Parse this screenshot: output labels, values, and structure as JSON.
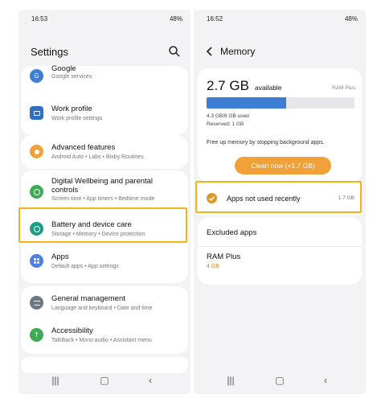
{
  "left_phone": {
    "status": {
      "time": "16:53",
      "right": "48%"
    },
    "header": {
      "title": "Settings"
    },
    "items": [
      {
        "title": "Google",
        "sub": "Google services",
        "icon": "google-icon",
        "color": "#3d7dd4"
      },
      {
        "title": "Work profile",
        "sub": "Work profile settings",
        "icon": "work-profile-icon",
        "color": "#2f6fbd"
      },
      {
        "title": "Advanced features",
        "sub": "Android Auto  •  Labs  •  Bixby Routines",
        "icon": "advanced-features-icon",
        "color": "#f0a13a"
      },
      {
        "title": "Digital Wellbeing and parental controls",
        "sub": "Screen time  •  App timers  •  Bedtime mode",
        "icon": "wellbeing-icon",
        "color": "#3fa956"
      },
      {
        "title": "Battery and device care",
        "sub": "Storage  •  Memory  •  Device protection",
        "icon": "device-care-icon",
        "color": "#1e9c86"
      },
      {
        "title": "Apps",
        "sub": "Default apps  •  App settings",
        "icon": "apps-icon",
        "color": "#4c7fe0"
      },
      {
        "title": "General management",
        "sub": "Language and keyboard  •  Date and time",
        "icon": "general-management-icon",
        "color": "#6b7784"
      },
      {
        "title": "Accessibility",
        "sub": "TalkBack  •  Mono audio  •  Assistant menu",
        "icon": "accessibility-icon",
        "color": "#3fa956"
      }
    ]
  },
  "right_phone": {
    "status": {
      "time": "16:52",
      "right": "48%"
    },
    "header": {
      "title": "Memory"
    },
    "memory": {
      "value": "2.7 GB",
      "available_label": "available",
      "ram_plus_label": "RAM Plus",
      "usage_fraction": 0.54,
      "used_text": "4.3 GB/8 GB used",
      "reserved_text": "Reserved: 1 GB",
      "free_text": "Free up memory by stopping background apps.",
      "clean_button": "Clean now (+1.7 GB)"
    },
    "apps_row": {
      "label": "Apps not used recently",
      "size": "1.7 GB"
    },
    "excluded": {
      "label": "Excluded apps"
    },
    "ram_plus": {
      "title": "RAM Plus",
      "sub": "4 GB"
    }
  },
  "colors": {
    "highlight": "#f0b41c",
    "accent": "#f0a13a",
    "bar_fill": "#3d7dd4"
  }
}
